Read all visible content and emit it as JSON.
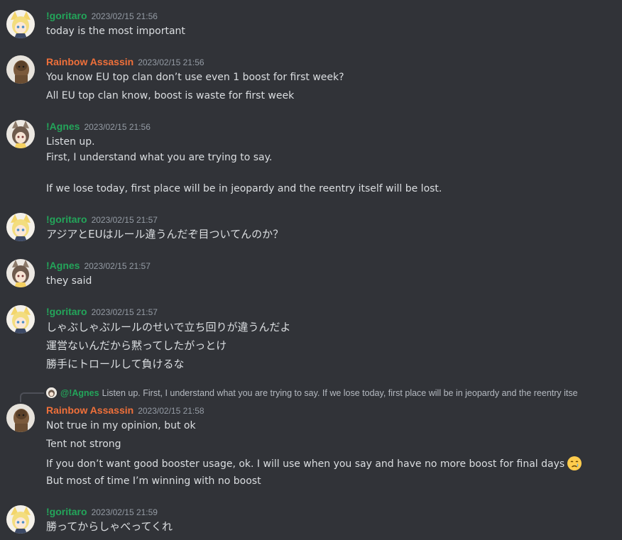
{
  "colors": {
    "background": "#313338",
    "text": "#dbdee1",
    "timestamp": "#949ba4",
    "name_green": "#23a55a",
    "name_orange": "#f0703a"
  },
  "messages": [
    {
      "author": "!goritaro",
      "timestamp": "2023/02/15 21:56",
      "avatar": "goritaro-avatar",
      "lines": [
        "today is the most important"
      ]
    },
    {
      "author": "Rainbow Assassin",
      "timestamp": "2023/02/15 21:56",
      "avatar": "rainbow-assassin-avatar",
      "lines": [
        "You know EU top clan don’t use even 1 boost for first week?",
        "All EU top clan know, boost is waste for first week"
      ]
    },
    {
      "author": "!Agnes",
      "timestamp": "2023/02/15 21:56",
      "avatar": "agnes-avatar",
      "lines": [
        "Listen up.",
        "First, I understand what you are trying to say.",
        "If we lose today, first place will be in jeopardy and the reentry itself will be lost."
      ]
    },
    {
      "author": "!goritaro",
      "timestamp": "2023/02/15 21:57",
      "avatar": "goritaro-avatar",
      "lines": [
        "アジアとEUはルール違うんだぞ目ついてんのか？"
      ]
    },
    {
      "author": "!Agnes",
      "timestamp": "2023/02/15 21:57",
      "avatar": "agnes-avatar",
      "lines": [
        "they said"
      ]
    },
    {
      "author": "!goritaro",
      "timestamp": "2023/02/15 21:57",
      "avatar": "goritaro-avatar",
      "lines": [
        "しゃぶしゃぶルールのせいで立ち回りが違うんだよ",
        "運営ないんだから黙ってしたがっとけ",
        "勝手にトロールして負けるな"
      ]
    },
    {
      "author": "Rainbow Assassin",
      "timestamp": "2023/02/15 21:58",
      "avatar": "rainbow-assassin-avatar",
      "reply": {
        "mention": "@!Agnes",
        "preview": "Listen up. First, I understand what you are trying to say. If we lose today, first place will be in jeopardy and the reentry itse"
      },
      "lines": [
        "Not true in my opinion, but ok",
        "Tent not strong",
        "If you don’t want good booster usage, ok. I will use when you say and have no more boost for final days",
        "But most of time I’m winning with no boost"
      ],
      "emoji": "crying-face-emoji"
    },
    {
      "author": "!goritaro",
      "timestamp": "2023/02/15 21:59",
      "avatar": "goritaro-avatar",
      "lines": [
        "勝ってからしゃべってくれ"
      ]
    }
  ]
}
